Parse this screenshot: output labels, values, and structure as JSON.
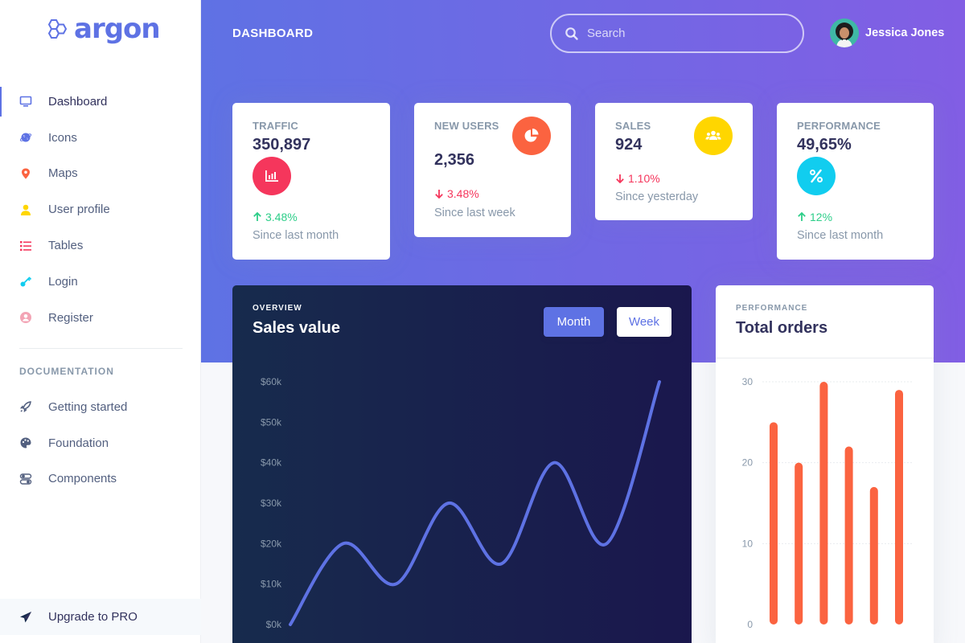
{
  "brand": {
    "name": "argon",
    "icon": "hexagons-logo-icon"
  },
  "sidebar": {
    "items": [
      {
        "label": "Dashboard",
        "icon": "monitor-icon",
        "color": "#5e72e4"
      },
      {
        "label": "Icons",
        "icon": "planet-icon",
        "color": "#5e72e4"
      },
      {
        "label": "Maps",
        "icon": "pin-icon",
        "color": "#fb6340"
      },
      {
        "label": "User profile",
        "icon": "user-icon",
        "color": "#ffd600"
      },
      {
        "label": "Tables",
        "icon": "bullet-list-icon",
        "color": "#f5365c"
      },
      {
        "label": "Login",
        "icon": "key-icon",
        "color": "#11cdef"
      },
      {
        "label": "Register",
        "icon": "circle-user-icon",
        "color": "#f3a4b5"
      }
    ],
    "doc_heading": "DOCUMENTATION",
    "doc_items": [
      {
        "label": "Getting started",
        "icon": "spaceship-icon"
      },
      {
        "label": "Foundation",
        "icon": "palette-icon"
      },
      {
        "label": "Components",
        "icon": "components-icon"
      }
    ],
    "upgrade_label": "Upgrade to PRO"
  },
  "header": {
    "title": "DASHBOARD",
    "search_placeholder": "Search",
    "user_name": "Jessica Jones"
  },
  "stats": [
    {
      "title": "TRAFFIC",
      "value": "350,897",
      "change": "3.48%",
      "direction": "up",
      "since": "Since last month",
      "icon": "chart-bar-icon",
      "icon_color": "#f5365c"
    },
    {
      "title": "NEW USERS",
      "value": "2,356",
      "change": "3.48%",
      "direction": "down",
      "since": "Since last week",
      "icon": "chart-pie-icon",
      "icon_color": "#fb6340"
    },
    {
      "title": "SALES",
      "value": "924",
      "change": "1.10%",
      "direction": "down",
      "since": "Since yesterday",
      "icon": "users-icon",
      "icon_color": "#ffd600"
    },
    {
      "title": "PERFORMANCE",
      "value": "49,65%",
      "change": "12%",
      "direction": "up",
      "since": "Since last month",
      "icon": "percent-icon",
      "icon_color": "#11cdef"
    }
  ],
  "sales_chart": {
    "eyebrow": "OVERVIEW",
    "title": "Sales value",
    "month_label": "Month",
    "week_label": "Week"
  },
  "orders_chart": {
    "eyebrow": "PERFORMANCE",
    "title": "Total orders"
  },
  "colors": {
    "primary": "#5e72e4",
    "up": "#2dce89",
    "down": "#f5365c",
    "bar": "#fb6340"
  },
  "chart_data": [
    {
      "type": "line",
      "title": "Sales value",
      "y_tick_labels": [
        "$0k",
        "$10k",
        "$20k",
        "$30k",
        "$40k",
        "$50k",
        "$60k"
      ],
      "ylim": [
        0,
        60
      ],
      "values": [
        0,
        20,
        10,
        30,
        15,
        40,
        20,
        60
      ],
      "grid": false
    },
    {
      "type": "bar",
      "title": "Total orders",
      "y_tick_labels": [
        "0",
        "10",
        "20",
        "30"
      ],
      "ylim": [
        0,
        30
      ],
      "values": [
        25,
        20,
        30,
        22,
        17,
        29
      ],
      "grid": true
    }
  ]
}
